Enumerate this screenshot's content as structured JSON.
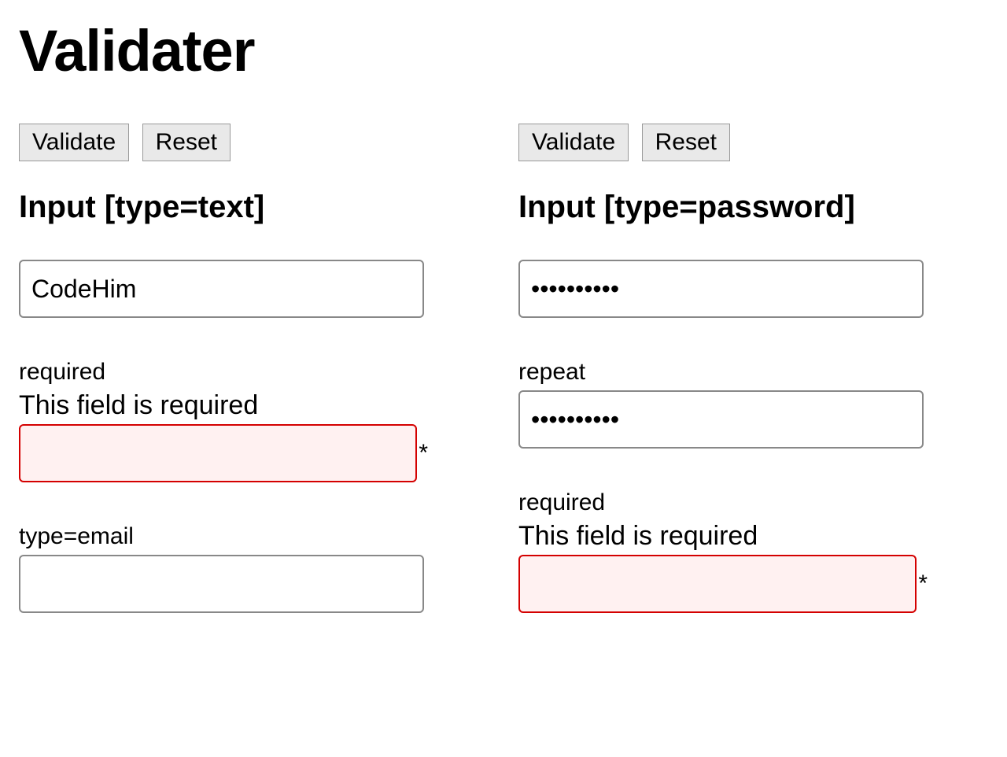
{
  "title": "Validater",
  "left": {
    "buttons": {
      "validate": "Validate",
      "reset": "Reset"
    },
    "heading": "Input [type=text]",
    "field1": {
      "value": "CodeHim"
    },
    "field2": {
      "label": "required",
      "error": "This field is required",
      "value": "",
      "asterisk": "*"
    },
    "field3": {
      "label": "type=email",
      "value": ""
    }
  },
  "right": {
    "buttons": {
      "validate": "Validate",
      "reset": "Reset"
    },
    "heading": "Input [type=password]",
    "field1": {
      "value": "••••••••••"
    },
    "field2": {
      "label": "repeat",
      "value": "••••••••••"
    },
    "field3": {
      "label": "required",
      "error": "This field is required",
      "value": "",
      "asterisk": "*"
    }
  }
}
